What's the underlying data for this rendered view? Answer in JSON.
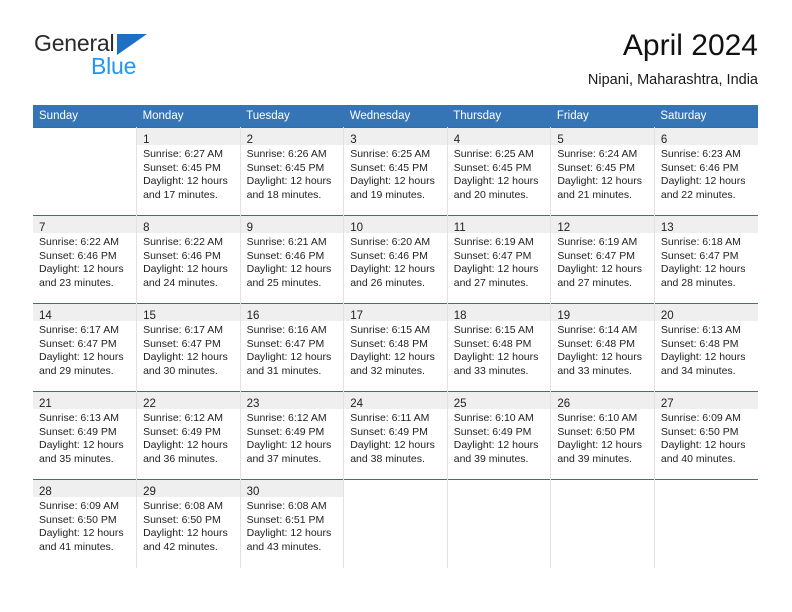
{
  "brand": {
    "word_top": "General",
    "word_bottom": "Blue",
    "triangle_color": "#1f6fc4",
    "blue_text_color": "#2196f3"
  },
  "header": {
    "title": "April 2024",
    "subtitle": "Nipani, Maharashtra, India"
  },
  "theme": {
    "header_bg": "#3575b5",
    "row_rule": "#2f6eb0",
    "daynum_band_bg": "#efefef"
  },
  "weekday_headers": [
    "Sunday",
    "Monday",
    "Tuesday",
    "Wednesday",
    "Thursday",
    "Friday",
    "Saturday"
  ],
  "weeks": [
    [
      {
        "day": "",
        "sunrise": "",
        "sunset": "",
        "daylight1": "",
        "daylight2": "",
        "empty": true
      },
      {
        "day": "1",
        "sunrise": "Sunrise: 6:27 AM",
        "sunset": "Sunset: 6:45 PM",
        "daylight1": "Daylight: 12 hours",
        "daylight2": "and 17 minutes."
      },
      {
        "day": "2",
        "sunrise": "Sunrise: 6:26 AM",
        "sunset": "Sunset: 6:45 PM",
        "daylight1": "Daylight: 12 hours",
        "daylight2": "and 18 minutes."
      },
      {
        "day": "3",
        "sunrise": "Sunrise: 6:25 AM",
        "sunset": "Sunset: 6:45 PM",
        "daylight1": "Daylight: 12 hours",
        "daylight2": "and 19 minutes."
      },
      {
        "day": "4",
        "sunrise": "Sunrise: 6:25 AM",
        "sunset": "Sunset: 6:45 PM",
        "daylight1": "Daylight: 12 hours",
        "daylight2": "and 20 minutes."
      },
      {
        "day": "5",
        "sunrise": "Sunrise: 6:24 AM",
        "sunset": "Sunset: 6:45 PM",
        "daylight1": "Daylight: 12 hours",
        "daylight2": "and 21 minutes."
      },
      {
        "day": "6",
        "sunrise": "Sunrise: 6:23 AM",
        "sunset": "Sunset: 6:46 PM",
        "daylight1": "Daylight: 12 hours",
        "daylight2": "and 22 minutes."
      }
    ],
    [
      {
        "day": "7",
        "sunrise": "Sunrise: 6:22 AM",
        "sunset": "Sunset: 6:46 PM",
        "daylight1": "Daylight: 12 hours",
        "daylight2": "and 23 minutes."
      },
      {
        "day": "8",
        "sunrise": "Sunrise: 6:22 AM",
        "sunset": "Sunset: 6:46 PM",
        "daylight1": "Daylight: 12 hours",
        "daylight2": "and 24 minutes."
      },
      {
        "day": "9",
        "sunrise": "Sunrise: 6:21 AM",
        "sunset": "Sunset: 6:46 PM",
        "daylight1": "Daylight: 12 hours",
        "daylight2": "and 25 minutes."
      },
      {
        "day": "10",
        "sunrise": "Sunrise: 6:20 AM",
        "sunset": "Sunset: 6:46 PM",
        "daylight1": "Daylight: 12 hours",
        "daylight2": "and 26 minutes."
      },
      {
        "day": "11",
        "sunrise": "Sunrise: 6:19 AM",
        "sunset": "Sunset: 6:47 PM",
        "daylight1": "Daylight: 12 hours",
        "daylight2": "and 27 minutes."
      },
      {
        "day": "12",
        "sunrise": "Sunrise: 6:19 AM",
        "sunset": "Sunset: 6:47 PM",
        "daylight1": "Daylight: 12 hours",
        "daylight2": "and 27 minutes."
      },
      {
        "day": "13",
        "sunrise": "Sunrise: 6:18 AM",
        "sunset": "Sunset: 6:47 PM",
        "daylight1": "Daylight: 12 hours",
        "daylight2": "and 28 minutes."
      }
    ],
    [
      {
        "day": "14",
        "sunrise": "Sunrise: 6:17 AM",
        "sunset": "Sunset: 6:47 PM",
        "daylight1": "Daylight: 12 hours",
        "daylight2": "and 29 minutes."
      },
      {
        "day": "15",
        "sunrise": "Sunrise: 6:17 AM",
        "sunset": "Sunset: 6:47 PM",
        "daylight1": "Daylight: 12 hours",
        "daylight2": "and 30 minutes."
      },
      {
        "day": "16",
        "sunrise": "Sunrise: 6:16 AM",
        "sunset": "Sunset: 6:47 PM",
        "daylight1": "Daylight: 12 hours",
        "daylight2": "and 31 minutes."
      },
      {
        "day": "17",
        "sunrise": "Sunrise: 6:15 AM",
        "sunset": "Sunset: 6:48 PM",
        "daylight1": "Daylight: 12 hours",
        "daylight2": "and 32 minutes."
      },
      {
        "day": "18",
        "sunrise": "Sunrise: 6:15 AM",
        "sunset": "Sunset: 6:48 PM",
        "daylight1": "Daylight: 12 hours",
        "daylight2": "and 33 minutes."
      },
      {
        "day": "19",
        "sunrise": "Sunrise: 6:14 AM",
        "sunset": "Sunset: 6:48 PM",
        "daylight1": "Daylight: 12 hours",
        "daylight2": "and 33 minutes."
      },
      {
        "day": "20",
        "sunrise": "Sunrise: 6:13 AM",
        "sunset": "Sunset: 6:48 PM",
        "daylight1": "Daylight: 12 hours",
        "daylight2": "and 34 minutes."
      }
    ],
    [
      {
        "day": "21",
        "sunrise": "Sunrise: 6:13 AM",
        "sunset": "Sunset: 6:49 PM",
        "daylight1": "Daylight: 12 hours",
        "daylight2": "and 35 minutes."
      },
      {
        "day": "22",
        "sunrise": "Sunrise: 6:12 AM",
        "sunset": "Sunset: 6:49 PM",
        "daylight1": "Daylight: 12 hours",
        "daylight2": "and 36 minutes."
      },
      {
        "day": "23",
        "sunrise": "Sunrise: 6:12 AM",
        "sunset": "Sunset: 6:49 PM",
        "daylight1": "Daylight: 12 hours",
        "daylight2": "and 37 minutes."
      },
      {
        "day": "24",
        "sunrise": "Sunrise: 6:11 AM",
        "sunset": "Sunset: 6:49 PM",
        "daylight1": "Daylight: 12 hours",
        "daylight2": "and 38 minutes."
      },
      {
        "day": "25",
        "sunrise": "Sunrise: 6:10 AM",
        "sunset": "Sunset: 6:49 PM",
        "daylight1": "Daylight: 12 hours",
        "daylight2": "and 39 minutes."
      },
      {
        "day": "26",
        "sunrise": "Sunrise: 6:10 AM",
        "sunset": "Sunset: 6:50 PM",
        "daylight1": "Daylight: 12 hours",
        "daylight2": "and 39 minutes."
      },
      {
        "day": "27",
        "sunrise": "Sunrise: 6:09 AM",
        "sunset": "Sunset: 6:50 PM",
        "daylight1": "Daylight: 12 hours",
        "daylight2": "and 40 minutes."
      }
    ],
    [
      {
        "day": "28",
        "sunrise": "Sunrise: 6:09 AM",
        "sunset": "Sunset: 6:50 PM",
        "daylight1": "Daylight: 12 hours",
        "daylight2": "and 41 minutes."
      },
      {
        "day": "29",
        "sunrise": "Sunrise: 6:08 AM",
        "sunset": "Sunset: 6:50 PM",
        "daylight1": "Daylight: 12 hours",
        "daylight2": "and 42 minutes."
      },
      {
        "day": "30",
        "sunrise": "Sunrise: 6:08 AM",
        "sunset": "Sunset: 6:51 PM",
        "daylight1": "Daylight: 12 hours",
        "daylight2": "and 43 minutes."
      },
      {
        "day": "",
        "sunrise": "",
        "sunset": "",
        "daylight1": "",
        "daylight2": "",
        "empty": true
      },
      {
        "day": "",
        "sunrise": "",
        "sunset": "",
        "daylight1": "",
        "daylight2": "",
        "empty": true
      },
      {
        "day": "",
        "sunrise": "",
        "sunset": "",
        "daylight1": "",
        "daylight2": "",
        "empty": true
      },
      {
        "day": "",
        "sunrise": "",
        "sunset": "",
        "daylight1": "",
        "daylight2": "",
        "empty": true
      }
    ]
  ]
}
